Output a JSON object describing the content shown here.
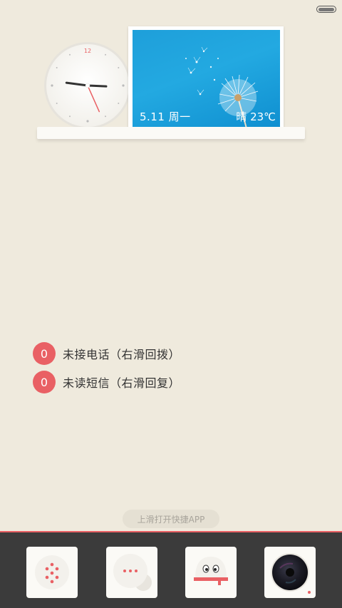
{
  "status_bar": {
    "battery_icon": "battery-icon"
  },
  "widget": {
    "clock": {
      "twelve_label": "12",
      "hour": 9,
      "minute": 15,
      "second": 26
    },
    "photo": {
      "date": "5.11 周一",
      "weather": "晴 23℃"
    }
  },
  "notifications": [
    {
      "count": "0",
      "label": "未接电话（右滑回拨）"
    },
    {
      "count": "0",
      "label": "未读短信（右滑回复）"
    }
  ],
  "swipe_hint": "上滑打开快捷APP",
  "dock": {
    "apps": [
      {
        "name": "dialer",
        "icon": "dialpad-icon"
      },
      {
        "name": "messages",
        "icon": "chat-bubble-icon"
      },
      {
        "name": "flashlight",
        "icon": "ghost-icon"
      },
      {
        "name": "camera",
        "icon": "camera-lens-icon"
      }
    ]
  },
  "colors": {
    "accent": "#e96064",
    "background": "#efeadd",
    "dock": "#3b3b3b"
  }
}
